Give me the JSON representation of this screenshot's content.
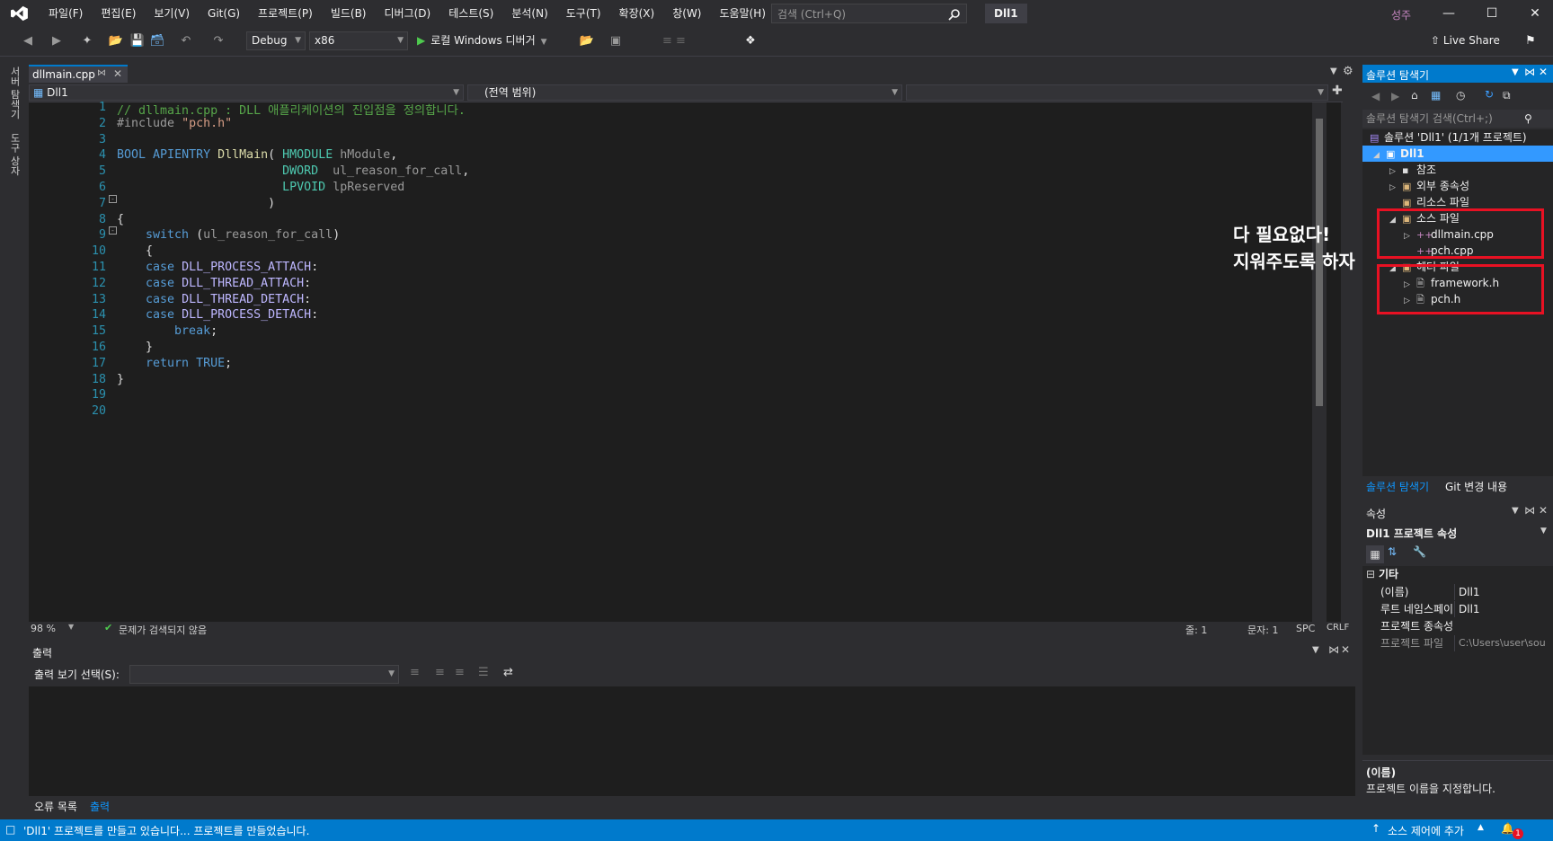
{
  "titlebar": {
    "menu": [
      "파일(F)",
      "편집(E)",
      "보기(V)",
      "Git(G)",
      "프로젝트(P)",
      "빌드(B)",
      "디버그(D)",
      "테스트(S)",
      "분석(N)",
      "도구(T)",
      "확장(X)",
      "창(W)",
      "도움말(H)"
    ],
    "search_placeholder": "검색 (Ctrl+Q)",
    "solution_name": "Dll1",
    "user": "성주"
  },
  "toolbar": {
    "config": "Debug",
    "platform": "x86",
    "run_label": "로컬 Windows 디버거",
    "live_share": "Live Share"
  },
  "left_strip": {
    "server_explorer": "서버 탐색기",
    "toolbox": "도구 상자"
  },
  "editor": {
    "tab_name": "dllmain.cpp",
    "nav_project": "Dll1",
    "nav_scope": "(전역 범위)",
    "line_numbers": [
      "1",
      "2",
      "3",
      "4",
      "5",
      "6",
      "7",
      "8",
      "9",
      "10",
      "11",
      "12",
      "13",
      "14",
      "15",
      "16",
      "17",
      "18",
      "19",
      "20"
    ],
    "status": {
      "zoom": "98 %",
      "issues": "문제가 검색되지 않음",
      "line": "줄: 1",
      "char": "문자: 1",
      "spc": "SPC",
      "eol": "CRLF"
    }
  },
  "code_lines": [
    "// dllmain.cpp : DLL 애플리케이션의 진입점을 정의합니다.",
    "#include \"pch.h\"",
    "",
    "BOOL APIENTRY DllMain( HMODULE hModule,",
    "                       DWORD  ul_reason_for_call,",
    "                       LPVOID lpReserved",
    "                     )",
    "{",
    "    switch (ul_reason_for_call)",
    "    {",
    "    case DLL_PROCESS_ATTACH:",
    "    case DLL_THREAD_ATTACH:",
    "    case DLL_THREAD_DETACH:",
    "    case DLL_PROCESS_DETACH:",
    "        break;",
    "    }",
    "    return TRUE;",
    "}",
    "",
    ""
  ],
  "output": {
    "title": "출력",
    "show_from_label": "출력 보기 선택(S):",
    "tabs": [
      "오류 목록",
      "출력"
    ]
  },
  "solution_explorer": {
    "title": "솔루션 탐색기",
    "search_placeholder": "솔루션 탐색기 검색(Ctrl+;)",
    "solution": "솔루션 'Dll1' (1/1개 프로젝트)",
    "project": "Dll1",
    "nodes": {
      "references": "참조",
      "external_deps": "외부 종속성",
      "resource_files": "리소스 파일",
      "source_files": "소스 파일",
      "dllmain": "dllmain.cpp",
      "pch_cpp": "pch.cpp",
      "header_files": "헤더 파일",
      "framework_h": "framework.h",
      "pch_h": "pch.h"
    },
    "tabs": [
      "솔루션 탐색기",
      "Git 변경 내용"
    ]
  },
  "annotation": {
    "line1": "다 필요없다!",
    "line2": "지워주도록 하자",
    "color": "#e81123"
  },
  "properties": {
    "title": "속성",
    "object": "Dll1  프로젝트 속성",
    "category": "기타",
    "rows": [
      {
        "k": "(이름)",
        "v": "Dll1"
      },
      {
        "k": "루트 네임스페이",
        "v": "Dll1"
      },
      {
        "k": "프로젝트 종속성",
        "v": ""
      },
      {
        "k": "프로젝트 파일",
        "v": "C:\\Users\\user\\sou"
      }
    ],
    "desc_title": "(이름)",
    "desc_text": "프로젝트 이름을 지정합니다."
  },
  "statusbar": {
    "message": "'Dll1' 프로젝트를 만들고 있습니다... 프로젝트를 만들었습니다.",
    "source_control": "소스 제어에 추가",
    "notif_count": "1"
  },
  "colors": {
    "accent": "#007acc",
    "keyword": "#569cd6",
    "comment": "#57a64a",
    "string": "#d69d85",
    "type": "#4ec9b0",
    "function": "#dcdcaa",
    "param": "#9cdcfe"
  }
}
